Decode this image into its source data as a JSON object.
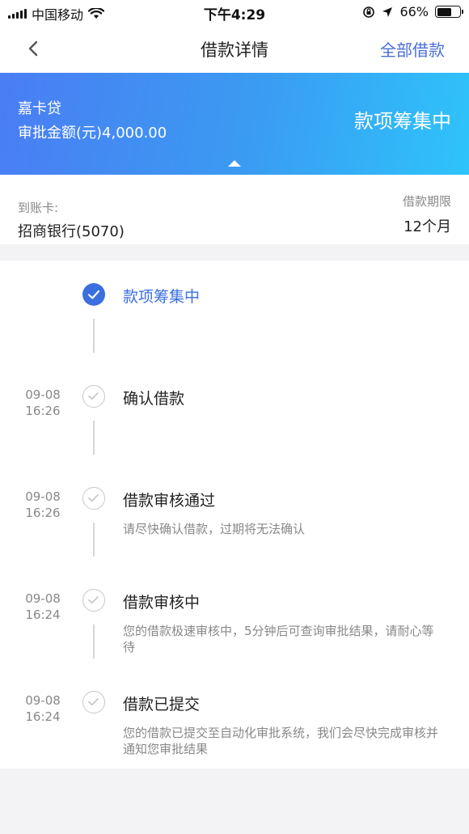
{
  "status_bar": {
    "carrier": "中国移动",
    "time": "下午4:29",
    "battery": "66%",
    "battery_level": 0.66
  },
  "nav": {
    "back_icon": "chevron-left-icon",
    "title": "借款详情",
    "right_link": "全部借款"
  },
  "banner": {
    "product": "嘉卡贷",
    "approved_amount": "审批金额(元)4,000.00",
    "status": "款项筹集中",
    "colors": {
      "start": "#4a7df3",
      "end": "#2ec4fb"
    }
  },
  "card_info": {
    "card_label": "到账卡:",
    "card_value": "招商银行(5070)",
    "term_label": "借款期限",
    "term_value": "12个月"
  },
  "timeline": [
    {
      "date": "",
      "time": "",
      "title": "款项筹集中",
      "desc": "",
      "state": "done"
    },
    {
      "date": "09-08",
      "time": "16:26",
      "title": "确认借款",
      "desc": "",
      "state": "pending"
    },
    {
      "date": "09-08",
      "time": "16:26",
      "title": "借款审核通过",
      "desc": "请尽快确认借款，过期将无法确认",
      "state": "pending"
    },
    {
      "date": "09-08",
      "time": "16:24",
      "title": "借款审核中",
      "desc": "您的借款极速审核中，5分钟后可查询审批结果，请耐心等待",
      "state": "pending"
    },
    {
      "date": "09-08",
      "time": "16:24",
      "title": "借款已提交",
      "desc": "您的借款已提交至自动化审批系统，我们会尽快完成审核并通知您审批结果",
      "state": "pending"
    }
  ],
  "accent_color": "#3b6fe0"
}
